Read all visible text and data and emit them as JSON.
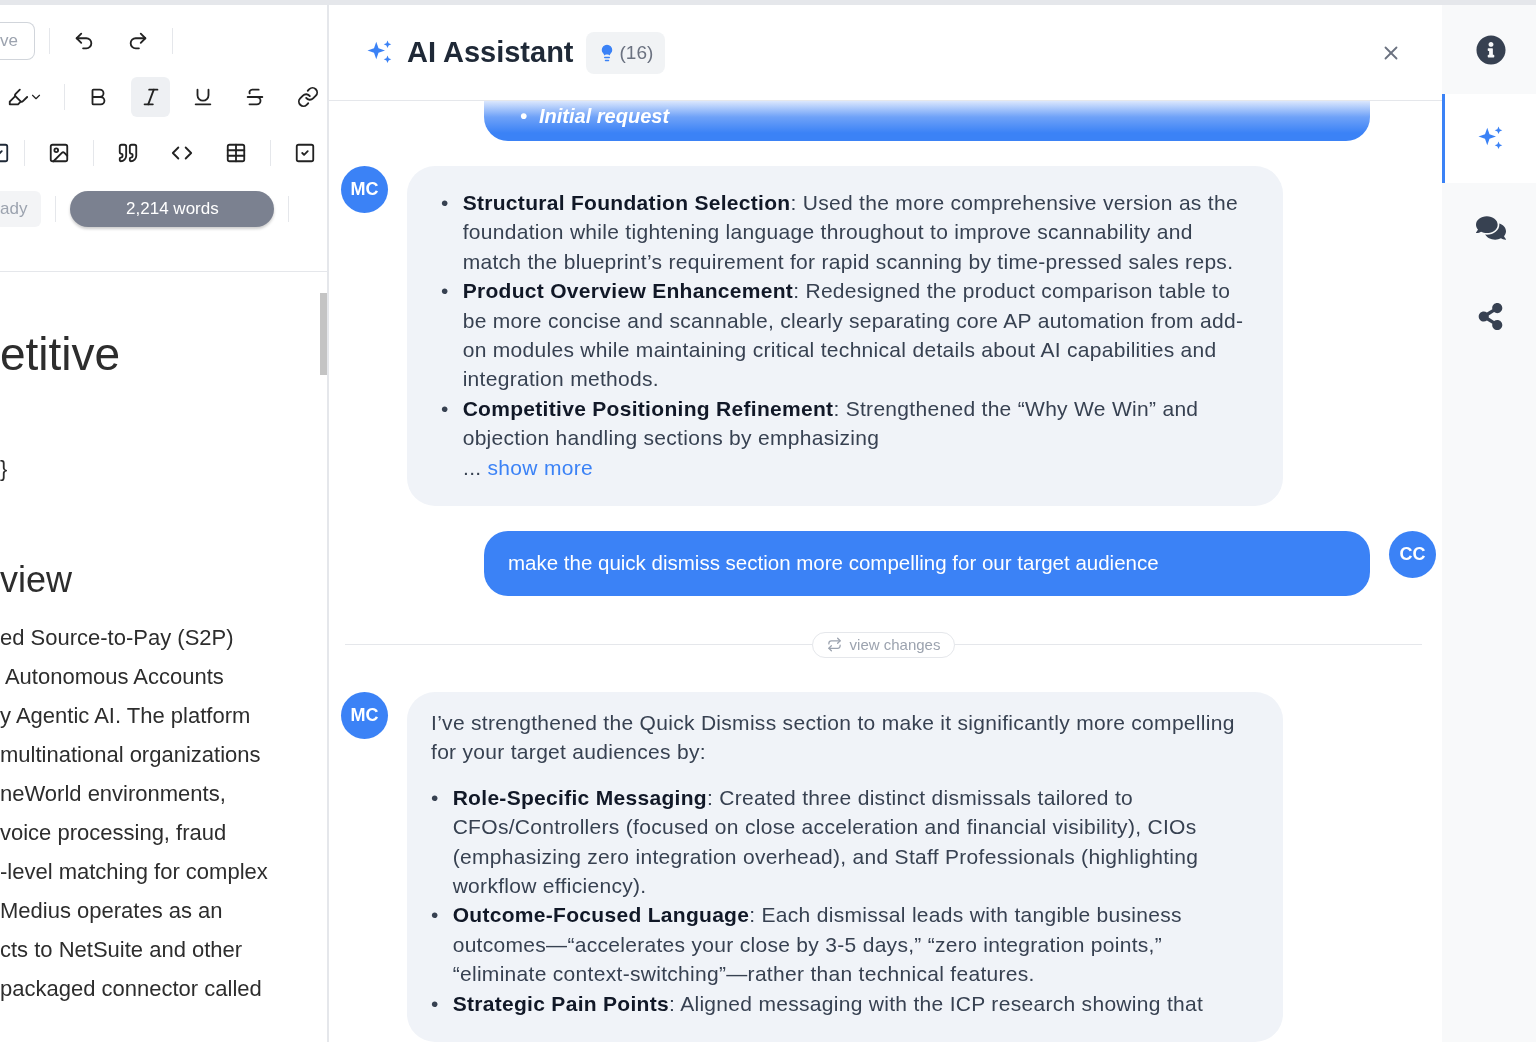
{
  "editor": {
    "save_button": "ve",
    "format_buttons": [
      {
        "kind": "bold",
        "selected": false
      },
      {
        "kind": "italic",
        "selected": true
      },
      {
        "kind": "underline",
        "selected": false
      },
      {
        "kind": "strike",
        "selected": false
      }
    ],
    "status": "ady",
    "word_count": "2,214 words",
    "blocks": [
      {
        "kind": "h1",
        "text": "etitive"
      },
      {
        "kind": "p",
        "text": "}"
      },
      {
        "kind": "h2",
        "text": "view"
      },
      {
        "kind": "line",
        "text": "ed Source-to-Pay (S2P)"
      },
      {
        "kind": "line",
        "text": " Autonomous Accounts"
      },
      {
        "kind": "line",
        "text": "y Agentic AI. The platform"
      },
      {
        "kind": "line",
        "text": "multinational organizations"
      },
      {
        "kind": "line",
        "text": "neWorld environments,"
      },
      {
        "kind": "line",
        "text": "voice processing, fraud"
      },
      {
        "kind": "line",
        "text": "-level matching for complex"
      },
      {
        "kind": "line",
        "text": "Medius operates as an"
      },
      {
        "kind": "line",
        "text": "cts to NetSuite and other"
      },
      {
        "kind": "line",
        "text": "packaged connector called"
      }
    ]
  },
  "assistant": {
    "title": "AI Assistant",
    "badge": "(16)",
    "messages": [
      {
        "kind": "faded",
        "marker": "•",
        "text": "Initial request"
      },
      {
        "kind": "assistant",
        "avatar": "MC",
        "marker": "•",
        "bullets": [
          "**Structural Foundation Selection**: Used the more comprehensive version as the foundation while tightening language throughout to improve scannability and match the blueprint’s requirement for rapid scanning by time-pressed sales reps.",
          "**Product Overview Enhancement**: Redesigned the product comparison table to be more concise and scannable, clearly separating core AP automation from add-on modules while maintaining critical technical details about AI capabilities and integration methods.",
          "**Competitive Positioning Refinement**: Strengthened the “Why We Win” and objection handling sections by emphasizing"
        ],
        "more_prefix": "...",
        "more_link": "show more"
      },
      {
        "kind": "user",
        "avatar": "CC",
        "text": "make the quick dismiss section more compelling for our target audience"
      },
      {
        "kind": "divider",
        "text": "view changes"
      },
      {
        "kind": "assistant",
        "avatar": "MC",
        "marker": "•",
        "intro": "I’ve strengthened the Quick Dismiss section to make it significantly more compelling for your target audiences by:",
        "bullets": [
          "**Role-Specific Messaging**: Created three distinct dismissals tailored to CFOs/Controllers (focused on close acceleration and financial visibility), CIOs (emphasizing zero integration overhead), and Staff Professionals (highlighting workflow efficiency).",
          "**Outcome-Focused Language**: Each dismissal leads with tangible business outcomes—“accelerates your close by 3-5 days,” “zero integration points,” “eliminate context-switching”—rather than technical features.",
          "**Strategic Pain Points**: Aligned messaging with the ICP research showing that"
        ]
      }
    ]
  },
  "rail": [
    {
      "kind": "info",
      "selected": false
    },
    {
      "kind": "assistant",
      "selected": true
    },
    {
      "kind": "comments",
      "selected": false
    },
    {
      "kind": "share",
      "selected": false
    }
  ]
}
